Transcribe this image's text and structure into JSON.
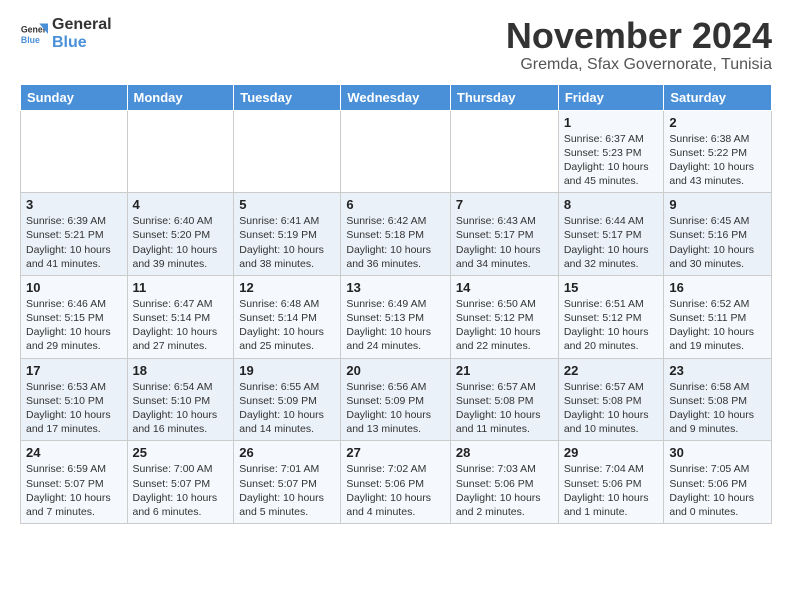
{
  "header": {
    "logo_line1": "General",
    "logo_line2": "Blue",
    "title": "November 2024",
    "subtitle": "Gremda, Sfax Governorate, Tunisia"
  },
  "days_of_week": [
    "Sunday",
    "Monday",
    "Tuesday",
    "Wednesday",
    "Thursday",
    "Friday",
    "Saturday"
  ],
  "weeks": [
    [
      {
        "day": "",
        "info": ""
      },
      {
        "day": "",
        "info": ""
      },
      {
        "day": "",
        "info": ""
      },
      {
        "day": "",
        "info": ""
      },
      {
        "day": "",
        "info": ""
      },
      {
        "day": "1",
        "info": "Sunrise: 6:37 AM\nSunset: 5:23 PM\nDaylight: 10 hours and 45 minutes."
      },
      {
        "day": "2",
        "info": "Sunrise: 6:38 AM\nSunset: 5:22 PM\nDaylight: 10 hours and 43 minutes."
      }
    ],
    [
      {
        "day": "3",
        "info": "Sunrise: 6:39 AM\nSunset: 5:21 PM\nDaylight: 10 hours and 41 minutes."
      },
      {
        "day": "4",
        "info": "Sunrise: 6:40 AM\nSunset: 5:20 PM\nDaylight: 10 hours and 39 minutes."
      },
      {
        "day": "5",
        "info": "Sunrise: 6:41 AM\nSunset: 5:19 PM\nDaylight: 10 hours and 38 minutes."
      },
      {
        "day": "6",
        "info": "Sunrise: 6:42 AM\nSunset: 5:18 PM\nDaylight: 10 hours and 36 minutes."
      },
      {
        "day": "7",
        "info": "Sunrise: 6:43 AM\nSunset: 5:17 PM\nDaylight: 10 hours and 34 minutes."
      },
      {
        "day": "8",
        "info": "Sunrise: 6:44 AM\nSunset: 5:17 PM\nDaylight: 10 hours and 32 minutes."
      },
      {
        "day": "9",
        "info": "Sunrise: 6:45 AM\nSunset: 5:16 PM\nDaylight: 10 hours and 30 minutes."
      }
    ],
    [
      {
        "day": "10",
        "info": "Sunrise: 6:46 AM\nSunset: 5:15 PM\nDaylight: 10 hours and 29 minutes."
      },
      {
        "day": "11",
        "info": "Sunrise: 6:47 AM\nSunset: 5:14 PM\nDaylight: 10 hours and 27 minutes."
      },
      {
        "day": "12",
        "info": "Sunrise: 6:48 AM\nSunset: 5:14 PM\nDaylight: 10 hours and 25 minutes."
      },
      {
        "day": "13",
        "info": "Sunrise: 6:49 AM\nSunset: 5:13 PM\nDaylight: 10 hours and 24 minutes."
      },
      {
        "day": "14",
        "info": "Sunrise: 6:50 AM\nSunset: 5:12 PM\nDaylight: 10 hours and 22 minutes."
      },
      {
        "day": "15",
        "info": "Sunrise: 6:51 AM\nSunset: 5:12 PM\nDaylight: 10 hours and 20 minutes."
      },
      {
        "day": "16",
        "info": "Sunrise: 6:52 AM\nSunset: 5:11 PM\nDaylight: 10 hours and 19 minutes."
      }
    ],
    [
      {
        "day": "17",
        "info": "Sunrise: 6:53 AM\nSunset: 5:10 PM\nDaylight: 10 hours and 17 minutes."
      },
      {
        "day": "18",
        "info": "Sunrise: 6:54 AM\nSunset: 5:10 PM\nDaylight: 10 hours and 16 minutes."
      },
      {
        "day": "19",
        "info": "Sunrise: 6:55 AM\nSunset: 5:09 PM\nDaylight: 10 hours and 14 minutes."
      },
      {
        "day": "20",
        "info": "Sunrise: 6:56 AM\nSunset: 5:09 PM\nDaylight: 10 hours and 13 minutes."
      },
      {
        "day": "21",
        "info": "Sunrise: 6:57 AM\nSunset: 5:08 PM\nDaylight: 10 hours and 11 minutes."
      },
      {
        "day": "22",
        "info": "Sunrise: 6:57 AM\nSunset: 5:08 PM\nDaylight: 10 hours and 10 minutes."
      },
      {
        "day": "23",
        "info": "Sunrise: 6:58 AM\nSunset: 5:08 PM\nDaylight: 10 hours and 9 minutes."
      }
    ],
    [
      {
        "day": "24",
        "info": "Sunrise: 6:59 AM\nSunset: 5:07 PM\nDaylight: 10 hours and 7 minutes."
      },
      {
        "day": "25",
        "info": "Sunrise: 7:00 AM\nSunset: 5:07 PM\nDaylight: 10 hours and 6 minutes."
      },
      {
        "day": "26",
        "info": "Sunrise: 7:01 AM\nSunset: 5:07 PM\nDaylight: 10 hours and 5 minutes."
      },
      {
        "day": "27",
        "info": "Sunrise: 7:02 AM\nSunset: 5:06 PM\nDaylight: 10 hours and 4 minutes."
      },
      {
        "day": "28",
        "info": "Sunrise: 7:03 AM\nSunset: 5:06 PM\nDaylight: 10 hours and 2 minutes."
      },
      {
        "day": "29",
        "info": "Sunrise: 7:04 AM\nSunset: 5:06 PM\nDaylight: 10 hours and 1 minute."
      },
      {
        "day": "30",
        "info": "Sunrise: 7:05 AM\nSunset: 5:06 PM\nDaylight: 10 hours and 0 minutes."
      }
    ]
  ]
}
